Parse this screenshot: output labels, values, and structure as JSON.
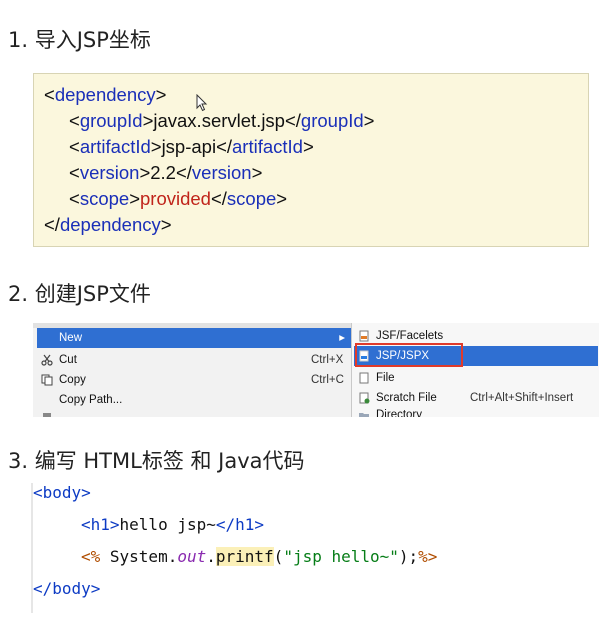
{
  "steps": {
    "s1": "1. 导入JSP坐标",
    "s2": "2. 创建JSP文件",
    "s3": "3. 编写 HTML标签 和 Java代码"
  },
  "xml": {
    "l1_open": "<",
    "l1_tag": "dependency",
    "l1_close": ">",
    "l2_open": "<",
    "l2_tag": "groupId",
    "l2_mid": ">javax.servlet.jsp</",
    "l2_tag2": "groupId",
    "l2_end": ">",
    "l3_open": "<",
    "l3_tag": "artifactId",
    "l3_mid": ">jsp-api</",
    "l3_tag2": "artifactId",
    "l3_end": ">",
    "l4_open": "<",
    "l4_tag": "version",
    "l4_mid": ">2.2</",
    "l4_tag2": "version",
    "l4_end": ">",
    "l5_open": "<",
    "l5_tag": "scope",
    "l5_gt": ">",
    "l5_val": "provided",
    "l5_lt": "</",
    "l5_tag2": "scope",
    "l5_end": ">",
    "l6_open": "</",
    "l6_tag": "dependency",
    "l6_end": ">"
  },
  "menu": {
    "new": "New",
    "cut": "Cut",
    "cut_shortcut": "Ctrl+X",
    "copy": "Copy",
    "copy_shortcut": "Ctrl+C",
    "copy_path": "Copy Path...",
    "sub_jsf": "JSF/Facelets",
    "sub_jsp": "JSP/JSPX",
    "sub_file": "File",
    "sub_scratch": "Scratch File",
    "sub_scratch_shortcut": "Ctrl+Alt+Shift+Insert",
    "sub_dir": "Directory",
    "arrow": "▸"
  },
  "code": {
    "l1": "<body>",
    "l2_open": "<h1>",
    "l2_text": "hello jsp~",
    "l2_close": "</h1>",
    "l3_open": "<%",
    "l3_sys": " System.",
    "l3_out": "out",
    "l3_dot": ".",
    "l3_fn": "printf",
    "l3_paren": "(",
    "l3_str": "\"jsp hello~\"",
    "l3_end": ");",
    "l3_close": "%>",
    "l4": "</body>"
  },
  "colors": {
    "xml_tag": "#1a2fb8",
    "xml_value_red": "#c0241a",
    "menu_selected": "#2f6fd2",
    "highlight_box": "#e03a2a",
    "code_string": "#067d17"
  }
}
